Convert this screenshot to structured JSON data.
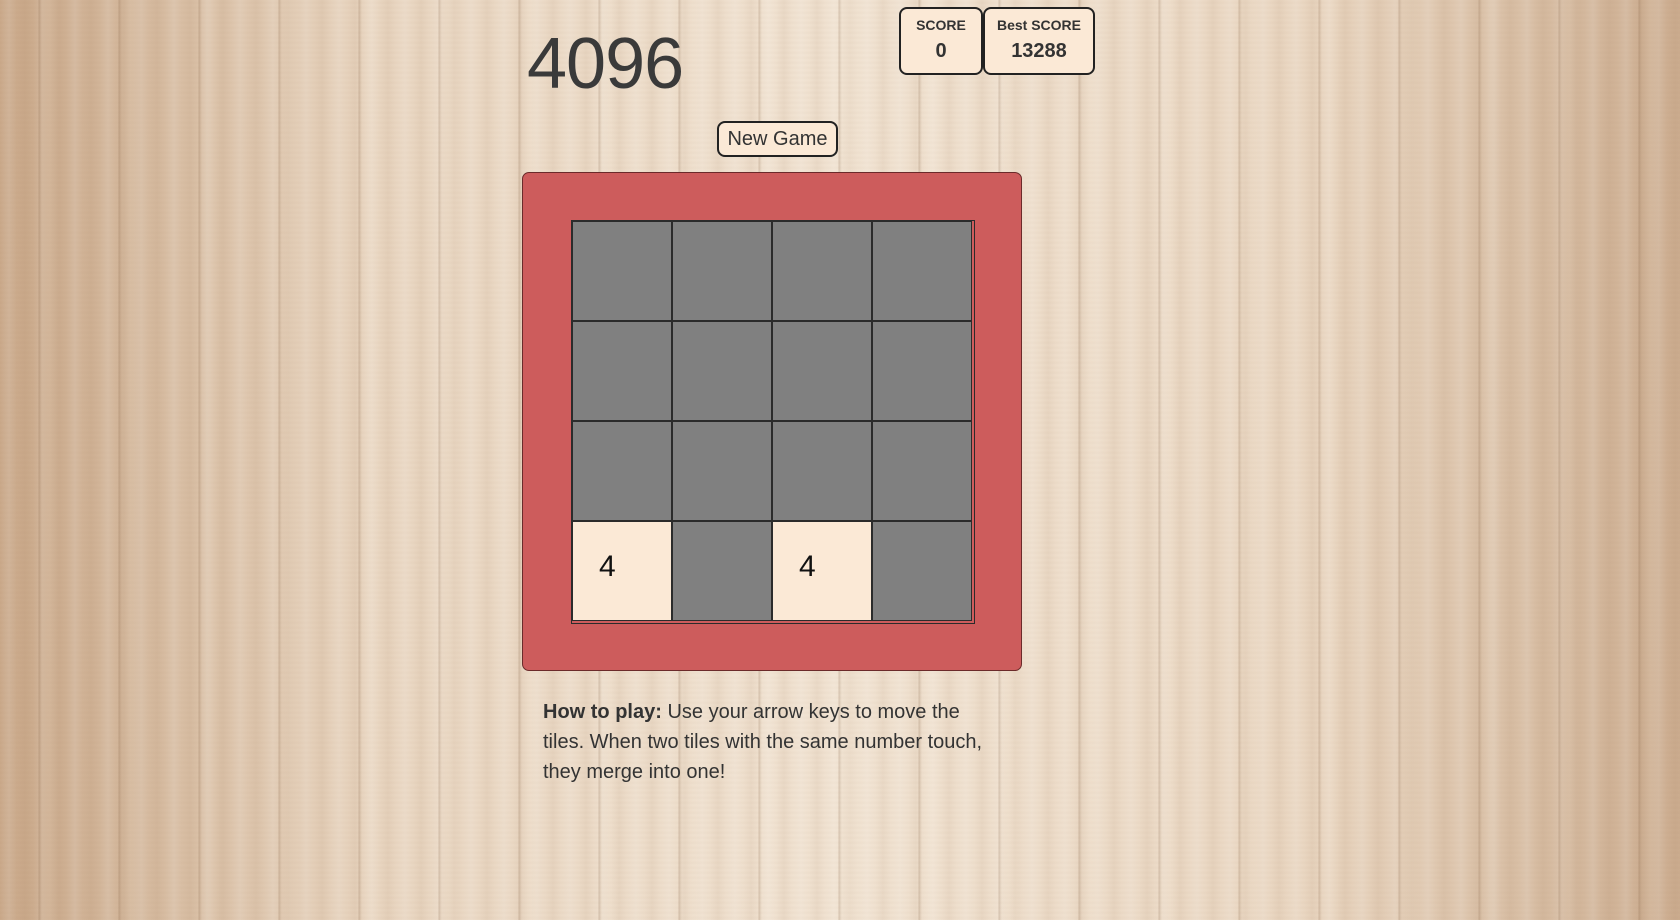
{
  "title": "4096",
  "score": {
    "label": "SCORE",
    "value": "0"
  },
  "best": {
    "label": "Best SCORE",
    "value": "13288"
  },
  "new_game_label": "New Game",
  "board": {
    "rows": [
      [
        "",
        "",
        "",
        ""
      ],
      [
        "",
        "",
        "",
        ""
      ],
      [
        "",
        "",
        "",
        ""
      ],
      [
        "4",
        "",
        "4",
        ""
      ]
    ]
  },
  "instructions": {
    "label": "How to play:",
    "text": " Use your arrow keys to move the tiles. When two tiles with the same number touch, they merge into one!"
  },
  "colors": {
    "frame": "#cd5c5c",
    "empty_cell": "#808080",
    "tile": "#fbe9d6",
    "score_box": "#fbe9d6"
  }
}
